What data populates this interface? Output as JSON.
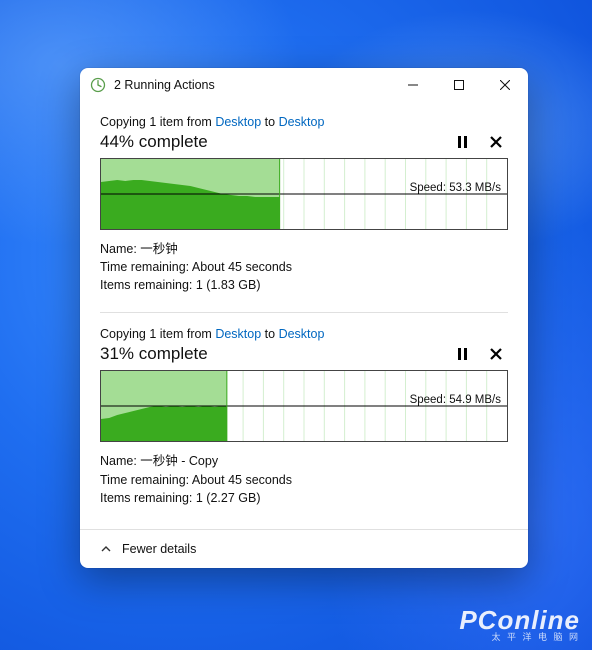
{
  "window": {
    "title": "2 Running Actions"
  },
  "actions": [
    {
      "desc_prefix": "Copying 1 item from ",
      "src": "Desktop",
      "to_word": " to ",
      "dst": "Desktop",
      "percent": 44,
      "complete_label": "44% complete",
      "speed_label": "Speed: 53.3 MB/s",
      "name_label": "Name: 一秒钟",
      "time_label": "Time remaining:  About 45 seconds",
      "items_label": "Items remaining:  1 (1.83 GB)"
    },
    {
      "desc_prefix": "Copying 1 item from ",
      "src": "Desktop",
      "to_word": " to ",
      "dst": "Desktop",
      "percent": 31,
      "complete_label": "31% complete",
      "speed_label": "Speed: 54.9 MB/s",
      "name_label": "Name: 一秒钟 - Copy",
      "time_label": "Time remaining:  About 45 seconds",
      "items_label": "Items remaining:  1 (2.27 GB)"
    }
  ],
  "footer": {
    "label": "Fewer details"
  },
  "watermark": {
    "big": "PConline",
    "small": "太 平 洋 电 脑 网"
  },
  "chart_data": [
    {
      "type": "area",
      "x_range_pct": [
        0,
        44
      ],
      "y_axis": "transfer speed (MB/s)",
      "ylim": [
        0,
        120
      ],
      "midline_value": 60,
      "series": [
        {
          "name": "speed",
          "values_MBps": [
            80,
            82,
            84,
            83,
            85,
            84,
            82,
            80,
            79,
            78,
            76,
            74,
            70,
            66,
            62,
            58,
            56,
            55,
            54,
            53,
            53,
            53.3
          ]
        }
      ],
      "current_speed_MBps": 53.3
    },
    {
      "type": "area",
      "x_range_pct": [
        0,
        31
      ],
      "y_axis": "transfer speed (MB/s)",
      "ylim": [
        0,
        120
      ],
      "midline_value": 60,
      "series": [
        {
          "name": "speed",
          "values_MBps": [
            38,
            40,
            44,
            48,
            50,
            53,
            55,
            56,
            55,
            56,
            55,
            56,
            55,
            56,
            55,
            54.9
          ]
        }
      ],
      "current_speed_MBps": 54.9
    }
  ]
}
